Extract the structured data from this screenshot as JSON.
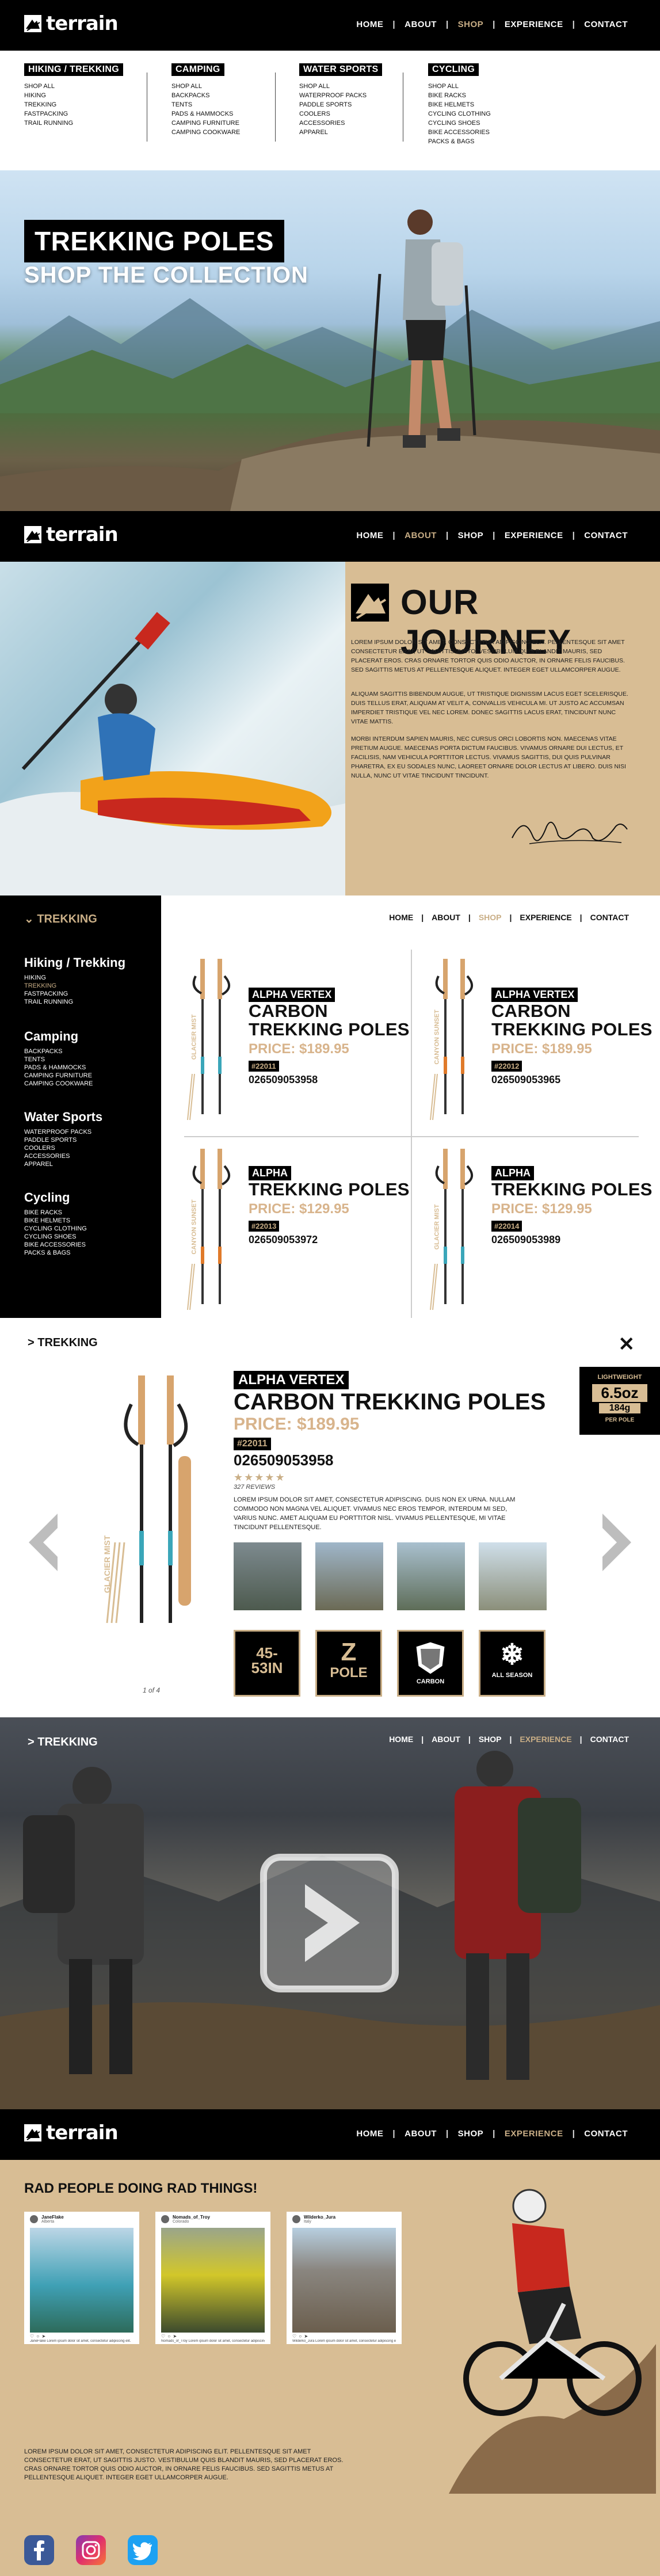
{
  "brand": {
    "name": "terrain"
  },
  "nav": {
    "home": "HOME",
    "about": "ABOUT",
    "shop": "SHOP",
    "experience": "EXPERIENCE",
    "contact": "CONTACT",
    "sep": "|"
  },
  "mega": {
    "hiking": {
      "title": "HIKING / TREKKING",
      "items": [
        "SHOP ALL",
        "HIKING",
        "TREKKING",
        "FASTPACKING",
        "TRAIL RUNNING"
      ]
    },
    "camping": {
      "title": "CAMPING",
      "items": [
        "SHOP ALL",
        "BACKPACKS",
        "TENTS",
        "PADS & HAMMOCKS",
        "CAMPING FURNITURE",
        "CAMPING COOKWARE"
      ]
    },
    "water": {
      "title": "WATER SPORTS",
      "items": [
        "SHOP ALL",
        "WATERPROOF PACKS",
        "PADDLE SPORTS",
        "COOLERS",
        "ACCESSORIES",
        "APPAREL"
      ]
    },
    "cycling": {
      "title": "CYCLING",
      "items": [
        "SHOP ALL",
        "BIKE RACKS",
        "BIKE HELMETS",
        "CYCLING CLOTHING",
        "CYCLING SHOES",
        "BIKE ACCESSORIES",
        "PACKS & BAGS"
      ]
    }
  },
  "hero": {
    "title": "TREKKING POLES",
    "subtitle": "SHOP THE COLLECTION"
  },
  "journey": {
    "title": "OUR JOURNEY",
    "p1": "Lorem ipsum dolor sit amet, consectetur adipiscing elit. Pellentesque sit amet consectetur erat, ut sagittis justo. Vestibulum quis blandit mauris, sed placerat eros. Cras ornare tortor quis odio auctor, in ornare felis faucibus. Sed sagittis metus at pellentesque aliquet. Integer eget ullamcorper augue.",
    "p2": "Aliquam sagittis bibendum augue, ut tristique dignissim lacus eget scelerisque. Duis tellus erat, aliquam at velit a, convallis vehicula mi. Ut justo ac accumsan imperdiet tristique vel nec lorem. Donec sagittis lacus erat, tincidunt nunc vitae mattis.",
    "p3": "Morbi interdum sapien mauris, nec cursus orci lobortis non. Maecenas vitae pretium augue. Maecenas porta dictum faucibus. Vivamus ornare dui lectus, et facilisis, nam vehicula porttitor lectus. Vivamus sagittis, dui quis pulvinar pharetra, ex eu sodales nunc, laoreet ornare dolor lectus at libero. Duis nisi nulla, nunc ut vitae tincidunt tincidunt."
  },
  "listing": {
    "section": "TREKKING",
    "groups": [
      {
        "title": "Hiking / Trekking",
        "items": [
          "HIKING",
          "TREKKING",
          "FASTPACKING",
          "TRAIL RUNNING"
        ],
        "active": 1
      },
      {
        "title": "Camping",
        "items": [
          "BACKPACKS",
          "TENTS",
          "PADS & HAMMOCKS",
          "CAMPING FURNITURE",
          "CAMPING COOKWARE"
        ]
      },
      {
        "title": "Water Sports",
        "items": [
          "WATERPROOF PACKS",
          "PADDLE SPORTS",
          "COOLERS",
          "ACCESSORIES",
          "APPAREL"
        ]
      },
      {
        "title": "Cycling",
        "items": [
          "BIKE RACKS",
          "BIKE HELMETS",
          "CYCLING CLOTHING",
          "CYCLING SHOES",
          "BIKE ACCESSORIES",
          "PACKS & BAGS"
        ]
      }
    ],
    "products": [
      {
        "tag": "ALPHA VERTEX",
        "line1": "CARBON",
        "line2": "TREKKING POLES",
        "price": "PRICE: $189.95",
        "sku": "#22011",
        "upc": "026509053958",
        "vertical": "GLACIER MIST"
      },
      {
        "tag": "ALPHA VERTEX",
        "line1": "CARBON",
        "line2": "TREKKING POLES",
        "price": "PRICE: $189.95",
        "sku": "#22012",
        "upc": "026509053965",
        "vertical": "CANYON SUNSET"
      },
      {
        "tag": "ALPHA",
        "line1": "",
        "line2": "TREKKING POLES",
        "price": "PRICE: $129.95",
        "sku": "#22013",
        "upc": "026509053972",
        "vertical": "CANYON SUNSET"
      },
      {
        "tag": "ALPHA",
        "line1": "",
        "line2": "TREKKING POLES",
        "price": "PRICE: $129.95",
        "sku": "#22014",
        "upc": "026509053989",
        "vertical": "GLACIER MIST"
      }
    ]
  },
  "detail": {
    "section": "TREKKING",
    "close": "✕",
    "tag": "ALPHA VERTEX",
    "name": "CARBON TREKKING POLES",
    "price": "PRICE: $189.95",
    "sku": "#22011",
    "upc": "026509053958",
    "stars": "★★★★★",
    "rating": 4.5,
    "reviews": "327 REVIEWS",
    "desc": "Lorem ipsum dolor sit amet, consectetur adipiscing. Duis non ex urna. Nullam commodo non magna vel aliquet. Vivamus nec eros tempor, interdum mi sed, varius nunc. Amet aliquam eu porttitor nisl. Vivamus pellentesque, mi vitae tincidunt pellentesque.",
    "weight": {
      "label": "LIGHTWEIGHT",
      "oz": "6.5oz",
      "g": "184g",
      "per": "PER POLE"
    },
    "features": [
      {
        "top": "45-",
        "bottom": "53IN",
        "icon": "length-icon"
      },
      {
        "top": "Z",
        "bottom": "POLE",
        "icon": "z-pole-icon"
      },
      {
        "top": "",
        "bottom": "CARBON",
        "icon": "carbon-badge-icon"
      },
      {
        "top": "",
        "bottom": "ALL SEASON",
        "icon": "snowflake-icon"
      }
    ],
    "pager": "1 of 4",
    "vertical": "GLACIER MIST"
  },
  "video": {
    "section": "TREKKING"
  },
  "community": {
    "title": "RAD PEOPLE DOING RAD THINGS!",
    "posts": [
      {
        "user": "JaneFlake",
        "sub": "Alberta",
        "caption": "JaneFlake Lorem ipsum dolor sit amet, consectetur adipiscing elit."
      },
      {
        "user": "Nomads_of_Troy",
        "sub": "Colorado",
        "caption": "Nomads_of_Troy Lorem ipsum dolor sit amet, consectetur adipiscing elit."
      },
      {
        "user": "Wilderko_Jura",
        "sub": "Italy",
        "caption": "Wilderko_Jura Lorem ipsum dolor sit amet, consectetur adipiscing elit."
      }
    ],
    "paragraph": "Lorem ipsum dolor sit amet, consectetur adipiscing elit. Pellentesque sit amet consectetur erat, ut sagittis justo. Vestibulum quis blandit mauris, sed placerat eros. Cras ornare tortor quis odio auctor, in ornare felis faucibus. Sed sagittis metus at pellentesque aliquet. Integer eget ullamcorper augue.",
    "social": [
      "facebook-icon",
      "instagram-icon",
      "twitter-icon"
    ]
  },
  "colors": {
    "black": "#000000",
    "tan": "#d8bd94",
    "gold": "#c9ae86",
    "price": "#d8b48c",
    "facebook": "#3b5998",
    "twitter": "#1da1f2"
  }
}
